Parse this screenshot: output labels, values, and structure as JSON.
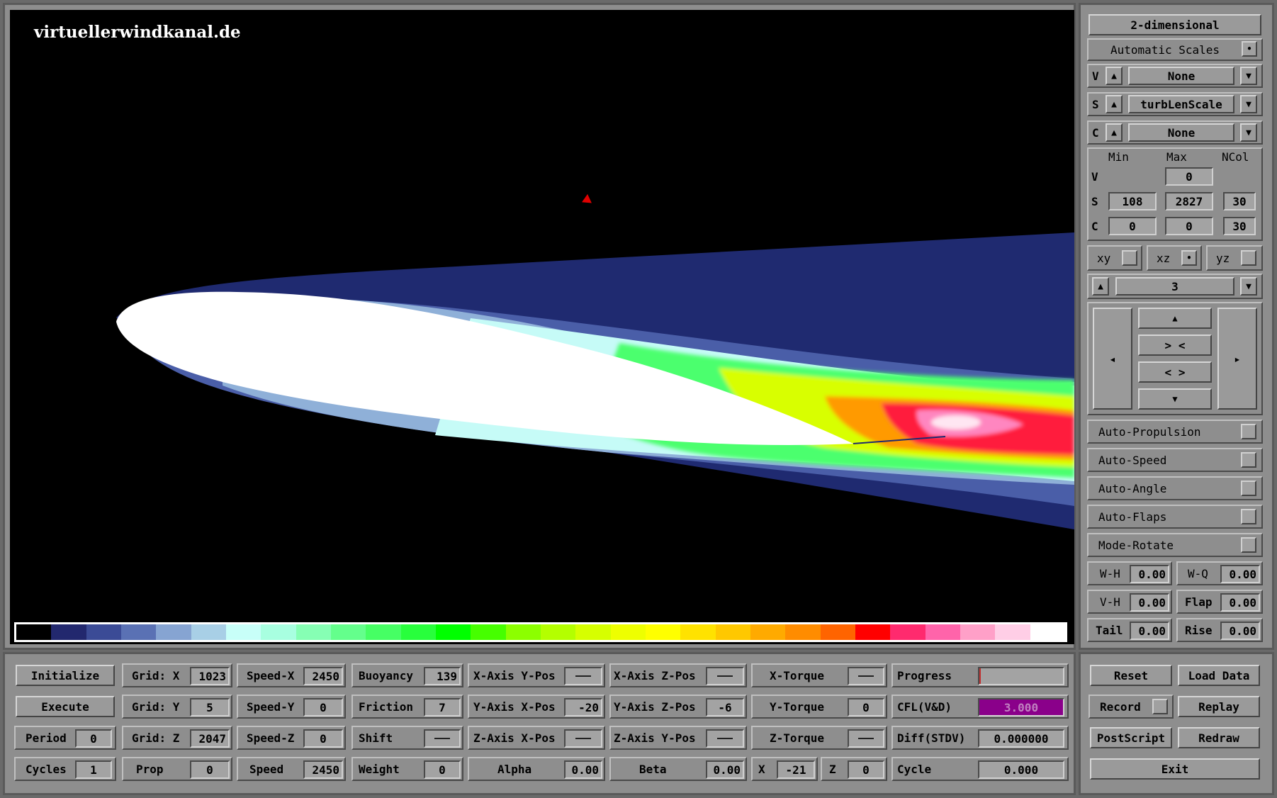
{
  "viewport": {
    "watermark": "virtuellerwindkanal.de"
  },
  "colorbar": [
    "#000000",
    "#22286e",
    "#3b4b96",
    "#5a71b4",
    "#86a4d2",
    "#a8cfe6",
    "#c8fff8",
    "#a8ffe0",
    "#86ffb4",
    "#64ff8c",
    "#46ff64",
    "#28ff3c",
    "#00ff00",
    "#46ff00",
    "#8cff00",
    "#b4ff00",
    "#d6ff00",
    "#eeff00",
    "#ffff00",
    "#ffe200",
    "#ffc800",
    "#ffaa00",
    "#ff8c00",
    "#ff6400",
    "#ff0000",
    "#ff2a6e",
    "#ff64aa",
    "#ffa0c8",
    "#ffcee6",
    "#ffffff"
  ],
  "side": {
    "mode": "2-dimensional",
    "auto_scales": "Automatic Scales",
    "rows": [
      {
        "letter": "V",
        "value": "None"
      },
      {
        "letter": "S",
        "value": "turbLenScale"
      },
      {
        "letter": "C",
        "value": "None"
      }
    ],
    "minmax": {
      "h_min": "Min",
      "h_max": "Max",
      "h_ncol": "NCol",
      "v": {
        "label": "V",
        "max": "0"
      },
      "s": {
        "label": "S",
        "min": "108",
        "max": "2827",
        "ncol": "30"
      },
      "c": {
        "label": "C",
        "min": "0",
        "max": "0",
        "ncol": "30"
      }
    },
    "planes": {
      "xy": "xy",
      "xz": "xz",
      "yz": "yz"
    },
    "level": "3",
    "nav": {
      "up": "▲",
      "zin": "> <",
      "zout": "< >",
      "down": "▼",
      "left": "◂",
      "right": "▸"
    },
    "toggles": [
      "Auto-Propulsion",
      "Auto-Speed",
      "Auto-Angle",
      "Auto-Flaps",
      "Mode-Rotate"
    ],
    "wparams": [
      {
        "l1": "W-H",
        "v1": "0.00",
        "l2": "W-Q",
        "v2": "0.00"
      },
      {
        "l1": "V-H",
        "v1": "0.00",
        "l2": "Flap",
        "v2": "0.00"
      },
      {
        "l1": "Tail",
        "v1": "0.00",
        "l2": "Rise",
        "v2": "0.00"
      }
    ]
  },
  "bottom": {
    "initialize": "Initialize",
    "execute": "Execute",
    "period": "Period",
    "period_v": "0",
    "cycles": "Cycles",
    "cycles_v": "1",
    "gridx": "Grid: X",
    "gridx_v": "1023",
    "gridy": "Grid: Y",
    "gridy_v": "5",
    "gridz": "Grid: Z",
    "gridz_v": "2047",
    "prop": "Prop",
    "prop_v": "0",
    "speedx": "Speed-X",
    "speedx_v": "2450",
    "speedy": "Speed-Y",
    "speedy_v": "0",
    "speedz": "Speed-Z",
    "speedz_v": "0",
    "speed": "Speed",
    "speed_v": "2450",
    "buoy": "Buoyancy",
    "buoy_v": "139",
    "fric": "Friction",
    "fric_v": "7",
    "shift": "Shift",
    "weight": "Weight",
    "weight_v": "0",
    "xaxy": "X-Axis Y-Pos",
    "yaxx": "Y-Axis X-Pos",
    "yaxx_v": "-20",
    "zaxx": "Z-Axis X-Pos",
    "alpha": "Alpha",
    "alpha_v": "0.00",
    "xaxz": "X-Axis Z-Pos",
    "yaxz": "Y-Axis Z-Pos",
    "yaxz_v": "-6",
    "zaxy": "Z-Axis Y-Pos",
    "beta": "Beta",
    "beta_v": "0.00",
    "xt": "X-Torque",
    "yt": "Y-Torque",
    "yt_v": "0",
    "zt": "Z-Torque",
    "x": "X",
    "x_v": "-21",
    "z": "Z",
    "z_v": "0",
    "progress": "Progress",
    "cfl": "CFL(V&D)",
    "cfl_v": "3.000",
    "diff": "Diff(STDV)",
    "diff_v": "0.000000",
    "cycle": "Cycle",
    "cycle_v": "0.000",
    "reset": "Reset",
    "load": "Load Data",
    "record": "Record",
    "replay": "Replay",
    "postscript": "PostScript",
    "redraw": "Redraw",
    "exit": "Exit"
  },
  "colors": {
    "cfl_fill": "#8a008a",
    "viewport_bg": "#000000",
    "panel": "#8e8e8e"
  }
}
